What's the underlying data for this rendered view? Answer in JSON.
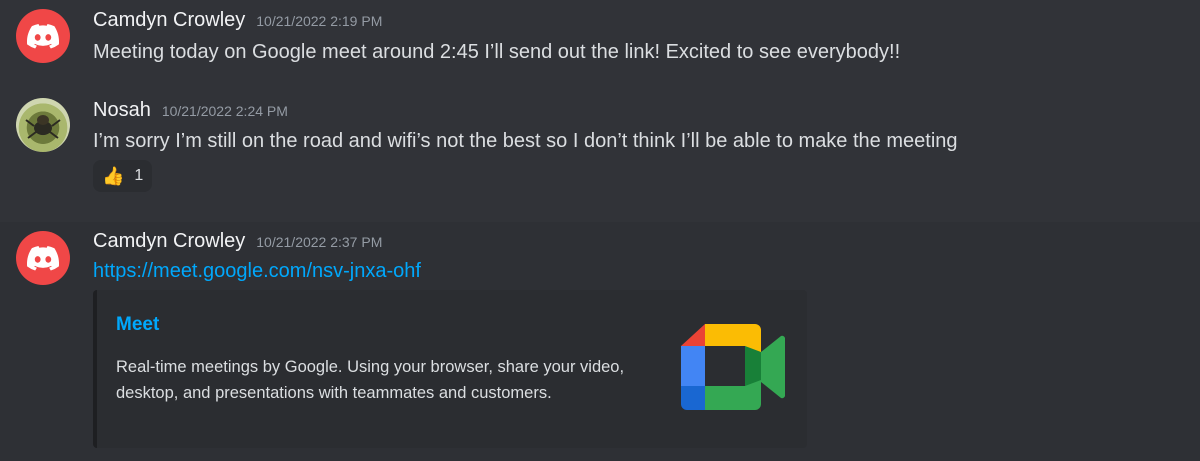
{
  "colors": {
    "background": "#313338",
    "discord_red": "#f04747",
    "link": "#00a8fc",
    "embed_bg": "#2b2d31"
  },
  "messages": [
    {
      "username": "Camdyn Crowley",
      "timestamp": "10/21/2022 2:19 PM",
      "avatar_icon": "discord-logo-icon",
      "text": "Meeting today on Google meet  around 2:45 I’ll send out the link! Excited to see everybody!!"
    },
    {
      "username": "Nosah",
      "timestamp": "10/21/2022 2:24 PM",
      "avatar_icon": "photo-avatar",
      "text": "I’m sorry I’m still on the road and wifi’s not the best so I don’t think I’ll be able to make the meeting",
      "reaction": {
        "emoji": "👍",
        "count": "1"
      }
    },
    {
      "username": "Camdyn Crowley",
      "timestamp": "10/21/2022 2:37 PM",
      "avatar_icon": "discord-logo-icon",
      "link": "https://meet.google.com/nsv-jnxa-ohf",
      "embed": {
        "title": "Meet",
        "description": "Real-time meetings by Google. Using your browser, share your video, desktop, and presentations with teammates and customers.",
        "thumbnail_icon": "google-meet-icon"
      }
    }
  ]
}
